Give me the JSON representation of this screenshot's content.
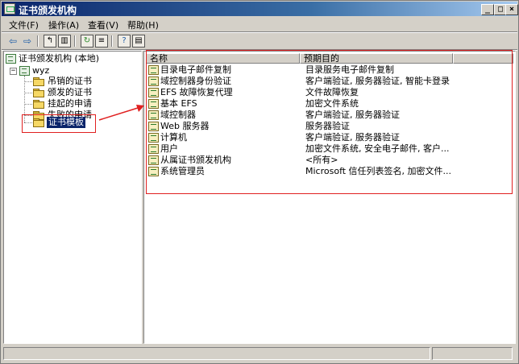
{
  "window": {
    "title": "证书颁发机构"
  },
  "menu": [
    "文件(F)",
    "操作(A)",
    "查看(V)",
    "帮助(H)"
  ],
  "toolbar": {
    "icons": [
      "back-icon",
      "forward-icon",
      "up-folder-icon",
      "show-hide-tree-icon",
      "refresh-icon",
      "export-list-icon",
      "help-icon",
      "properties-icon"
    ]
  },
  "tree": {
    "root": "证书颁发机构 (本地)",
    "ca": "wyz",
    "folders": [
      "吊销的证书",
      "颁发的证书",
      "挂起的申请",
      "失败的申请",
      "证书模板"
    ],
    "selected": "证书模板"
  },
  "list": {
    "columns": [
      "名称",
      "预期目的"
    ],
    "rows": [
      {
        "name": "目录电子邮件复制",
        "purpose": "目录服务电子邮件复制"
      },
      {
        "name": "域控制器身份验证",
        "purpose": "客户端验证, 服务器验证, 智能卡登录"
      },
      {
        "name": "EFS 故障恢复代理",
        "purpose": "文件故障恢复"
      },
      {
        "name": "基本 EFS",
        "purpose": "加密文件系统"
      },
      {
        "name": "域控制器",
        "purpose": "客户端验证, 服务器验证"
      },
      {
        "name": "Web 服务器",
        "purpose": "服务器验证"
      },
      {
        "name": "计算机",
        "purpose": "客户端验证, 服务器验证"
      },
      {
        "name": "用户",
        "purpose": "加密文件系统, 安全电子邮件, 客户..."
      },
      {
        "name": "从属证书颁发机构",
        "purpose": "<所有>"
      },
      {
        "name": "系统管理员",
        "purpose": "Microsoft 信任列表签名, 加密文件..."
      }
    ]
  },
  "annotation": {
    "color": "#e02020"
  },
  "colors": {
    "titlebar": "#0a246a",
    "selection": "#0a246a",
    "chrome": "#d4d0c8"
  }
}
